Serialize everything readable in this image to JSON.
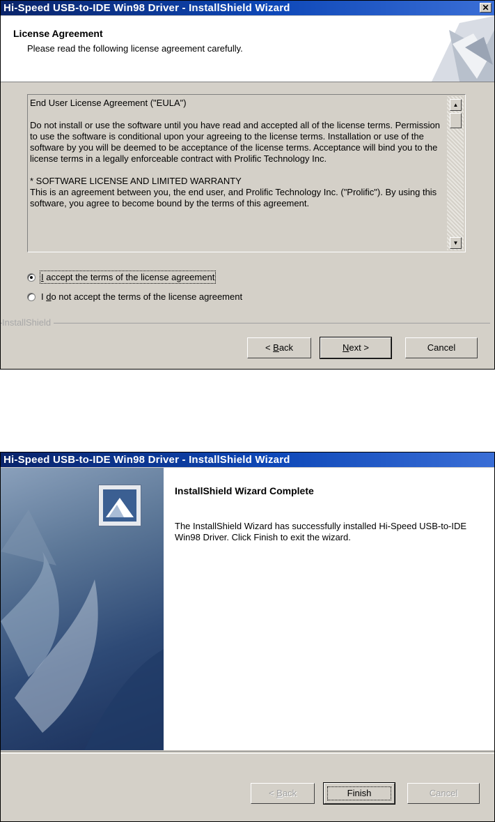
{
  "window1": {
    "title": "Hi-Speed USB-to-IDE Win98 Driver - InstallShield Wizard",
    "close_glyph": "✕",
    "header_title": "License Agreement",
    "header_subtitle": "Please read the following license agreement carefully.",
    "license_paragraphs": [
      "End User License Agreement (\"EULA\")",
      "Do not install or use the software until you have read and accepted all of the license terms. Permission to use the software is conditional upon your agreeing to the license terms. Installation or use of the software by you will be deemed to be acceptance of the license terms. Acceptance will bind you to the license terms in a legally enforceable contract with Prolific Technology Inc.",
      "* SOFTWARE LICENSE AND LIMITED WARRANTY\nThis is an agreement between you, the end user, and Prolific Technology Inc. (\"Prolific\"). By using this software, you agree to become bound by the terms of this agreement."
    ],
    "scroll_up_glyph": "▲",
    "scroll_down_glyph": "▼",
    "radio_accept_label_pre": "",
    "radio_accept_label_u": "I",
    "radio_accept_label_post": " accept the terms of the license agreement",
    "radio_decline_label_pre": "I ",
    "radio_decline_label_u": "d",
    "radio_decline_label_post": "o not accept the terms of the license agreement",
    "radio_accept_checked": true,
    "brand": "InstallShield",
    "back_pre": "< ",
    "back_u": "B",
    "back_post": "ack",
    "next_u": "N",
    "next_post": "ext >",
    "cancel": "Cancel"
  },
  "window2": {
    "title": "Hi-Speed USB-to-IDE Win98 Driver - InstallShield Wizard",
    "complete_title": "InstallShield Wizard Complete",
    "complete_text": "The InstallShield Wizard has successfully installed Hi-Speed USB-to-IDE Win98 Driver.  Click Finish to exit the wizard.",
    "back_pre": "< ",
    "back_u": "B",
    "back_post": "ack",
    "finish": "Finish",
    "cancel": "Cancel"
  },
  "colors": {
    "titlebar_start": "#0a246a",
    "titlebar_end": "#3a6ed6",
    "dialog_face": "#d4d0c8"
  }
}
